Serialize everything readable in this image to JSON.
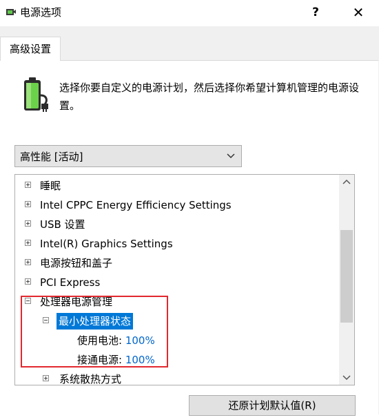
{
  "window": {
    "title": "电源选项",
    "help_label": "?",
    "close_label": "✕"
  },
  "tabs": [
    {
      "label": "高级设置"
    }
  ],
  "description": "选择你要自定义的电源计划，然后选择你希望计算机管理的电源设置。",
  "plan_select": {
    "value": "高性能 [活动]"
  },
  "tree": {
    "items": [
      {
        "label": "睡眠",
        "expander": "plus"
      },
      {
        "label": "Intel CPPC Energy Efficiency Settings",
        "expander": "plus"
      },
      {
        "label": "USB 设置",
        "expander": "plus"
      },
      {
        "label": "Intel(R) Graphics Settings",
        "expander": "plus"
      },
      {
        "label": "电源按钮和盖子",
        "expander": "plus"
      },
      {
        "label": "PCI Express",
        "expander": "plus"
      },
      {
        "label": "处理器电源管理",
        "expander": "minus"
      },
      {
        "label": "最小处理器状态",
        "expander": "minus",
        "selected": true
      },
      {
        "label": "使用电池:",
        "value": "100%"
      },
      {
        "label": "接通电源:",
        "value": "100%"
      },
      {
        "label": "系统散热方式",
        "expander": "plus"
      }
    ]
  },
  "buttons": {
    "restore_label": "还原计划默认值(R)"
  },
  "colors": {
    "highlight_border": "#e2282e",
    "selection": "#0078d7",
    "value_text": "#0066cc"
  }
}
